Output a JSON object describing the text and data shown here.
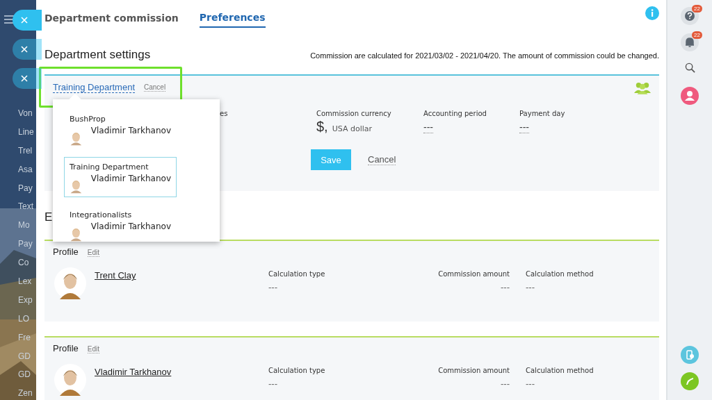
{
  "sidebar": {
    "close_buttons": [
      {
        "active": true
      },
      {
        "active": false
      },
      {
        "active": false
      }
    ],
    "items": [
      "Von",
      "Line",
      "Trel",
      "Asa",
      "Pay",
      "Text",
      "Mo",
      "Pay",
      "Co",
      "Lex",
      "Exp",
      "LO",
      "Fre",
      "GD",
      "GD",
      "Zen"
    ]
  },
  "tabs": [
    {
      "label": "Department commission",
      "selected": false
    },
    {
      "label": "Preferences",
      "selected": true
    }
  ],
  "section_title": "Department settings",
  "notice": "Commission are calculated for 2021/03/02 - 2021/04/20. The amount of commission could be changed.",
  "department": {
    "name": "Training Department",
    "cancel_link": "Cancel",
    "fields": [
      {
        "kind": "partial",
        "label": "es"
      },
      {
        "kind": "currency",
        "label": "Commission currency",
        "symbol": "$,",
        "value": "USA dollar"
      },
      {
        "kind": "plain",
        "label": "Accounting period",
        "value": "---"
      },
      {
        "kind": "plain",
        "label": "Payment day",
        "value": "---"
      }
    ],
    "save": "Save",
    "cancel": "Cancel"
  },
  "dropdown": [
    {
      "group": "BushProp",
      "person": "Vladimir Tarkhanov",
      "selected": false
    },
    {
      "group": "Training Department",
      "person": "Vladimir Tarkhanov",
      "selected": true
    },
    {
      "group": "Integrationalists",
      "person": "Vladimir Tarkhanov",
      "selected": false
    }
  ],
  "employees_title": "E",
  "profiles": [
    {
      "title": "Profile",
      "edit": "Edit",
      "name": "Trent Clay",
      "fields": [
        {
          "label": "Calculation type",
          "value": "---"
        },
        {
          "label": "Commission amount",
          "value": "---"
        },
        {
          "label": "Calculation method",
          "value": "---"
        }
      ]
    },
    {
      "title": "Profile",
      "edit": "Edit",
      "name": "Vladimir Tarkhanov",
      "fields": [
        {
          "label": "Calculation type",
          "value": "---"
        },
        {
          "label": "Commission amount",
          "value": "---"
        },
        {
          "label": "Calculation method",
          "value": "---"
        }
      ]
    }
  ],
  "right_bar": {
    "help_badge": "22",
    "bell_badge": "22"
  }
}
